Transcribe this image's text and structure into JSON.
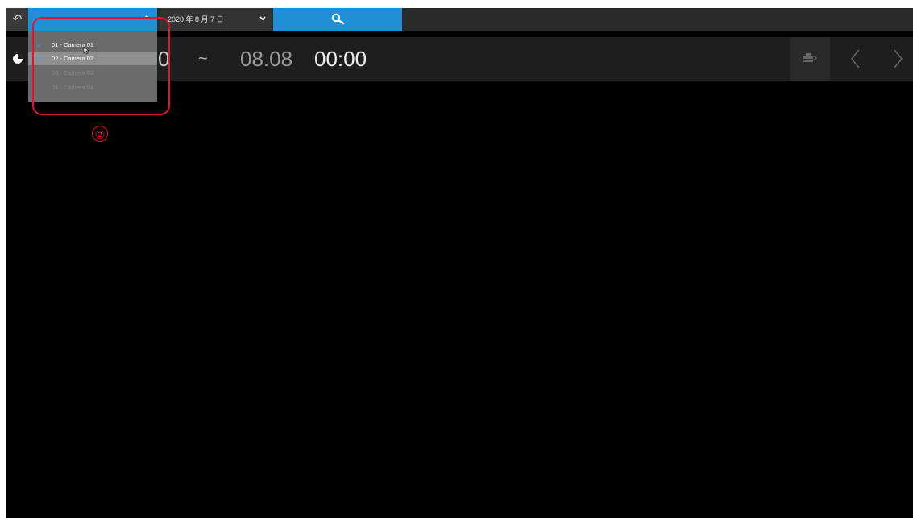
{
  "toolbar": {
    "back_icon": "undo-arrow-icon",
    "date_value": "2020 年 8 月 7 日",
    "search_icon": "search-icon",
    "accent_color": "#1f8fd6"
  },
  "timebar": {
    "start_time_partial": "0",
    "separator": "~",
    "end_date": "08.08",
    "end_time": "00:00",
    "clock_icon": "clock-icon",
    "export_icon": "export-icon",
    "prev_icon": "chevron-left-icon",
    "next_icon": "chevron-right-icon"
  },
  "camera_dropdown": {
    "items": [
      {
        "label": "01 - Camera 01",
        "checked": true
      },
      {
        "label": "02 - Camera 02",
        "checked": true
      },
      {
        "label": "03 - Camera 03",
        "checked": false
      },
      {
        "label": "04 - Camera 04",
        "checked": false
      }
    ]
  },
  "annotation": {
    "step_number": "②",
    "highlight_color": "#e4142b"
  }
}
